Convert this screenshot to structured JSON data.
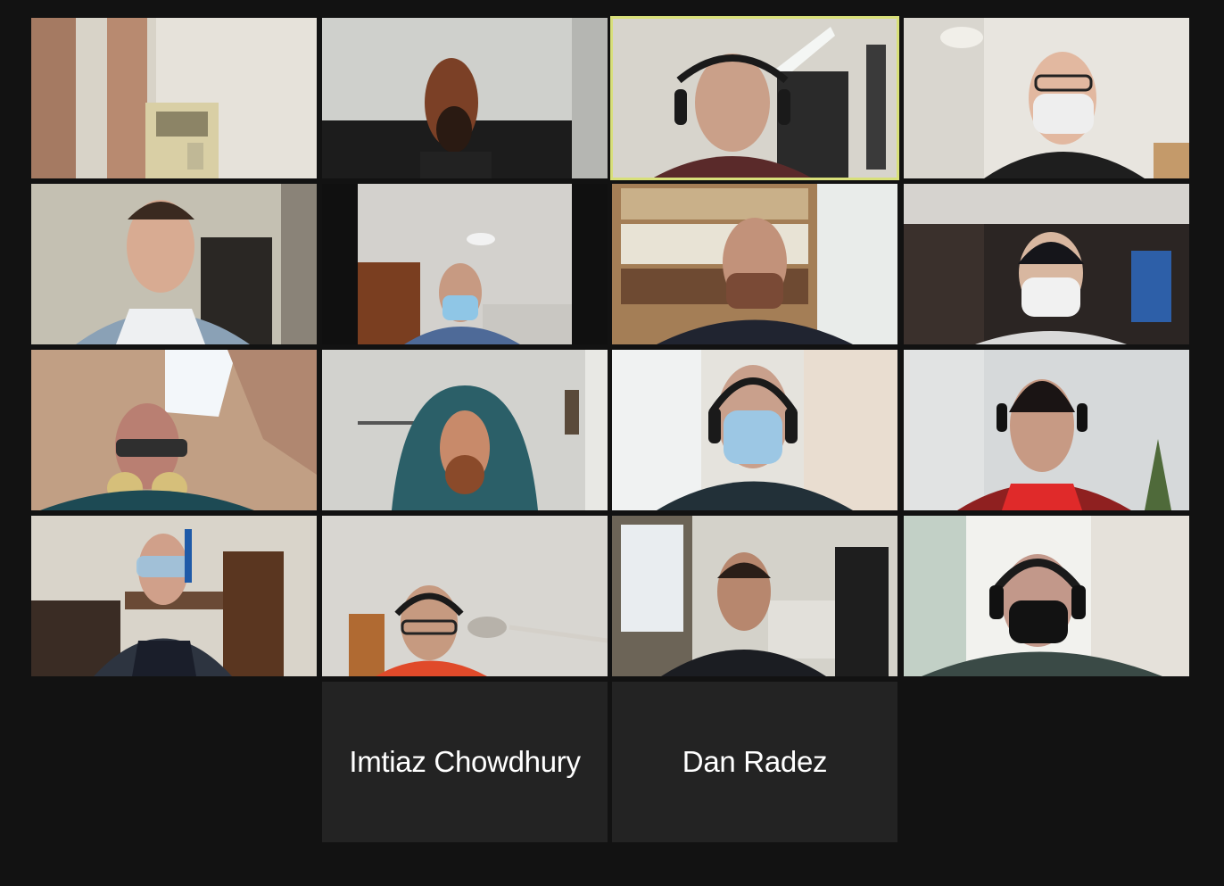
{
  "gallery": {
    "background_color": "#121212",
    "active_speaker_color": "#d8e07a",
    "name_tile_color": "#232323",
    "video_tiles": [
      {
        "id": "p1",
        "content": "room-with-curtains-and-air-conditioner"
      },
      {
        "id": "p2",
        "content": "person-in-horse-mask"
      },
      {
        "id": "p3",
        "content": "smiling-man-with-headphones",
        "active_speaker": true
      },
      {
        "id": "p4",
        "content": "man-with-glasses-and-white-mask"
      },
      {
        "id": "p5",
        "content": "smiling-man-in-raglan-shirt"
      },
      {
        "id": "p6",
        "content": "man-with-blue-mask-in-office"
      },
      {
        "id": "p7",
        "content": "man-with-brown-mask-bookshelf"
      },
      {
        "id": "p8",
        "content": "man-with-white-mask-closet"
      },
      {
        "id": "p9",
        "content": "man-with-gas-mask"
      },
      {
        "id": "p10",
        "content": "bearded-man-with-towel-hood"
      },
      {
        "id": "p11",
        "content": "man-with-headphones-and-blue-mask"
      },
      {
        "id": "p12",
        "content": "smiling-man-with-headset"
      },
      {
        "id": "p13",
        "content": "man-with-snorkel-goggles"
      },
      {
        "id": "p14",
        "content": "man-with-glasses-and-headphones"
      },
      {
        "id": "p15",
        "content": "smiling-man-with-earphones"
      },
      {
        "id": "p16",
        "content": "man-with-black-mask-and-headphones"
      }
    ],
    "name_tiles": [
      {
        "name": "Imtiaz Chowdhury"
      },
      {
        "name": "Dan Radez"
      }
    ]
  }
}
